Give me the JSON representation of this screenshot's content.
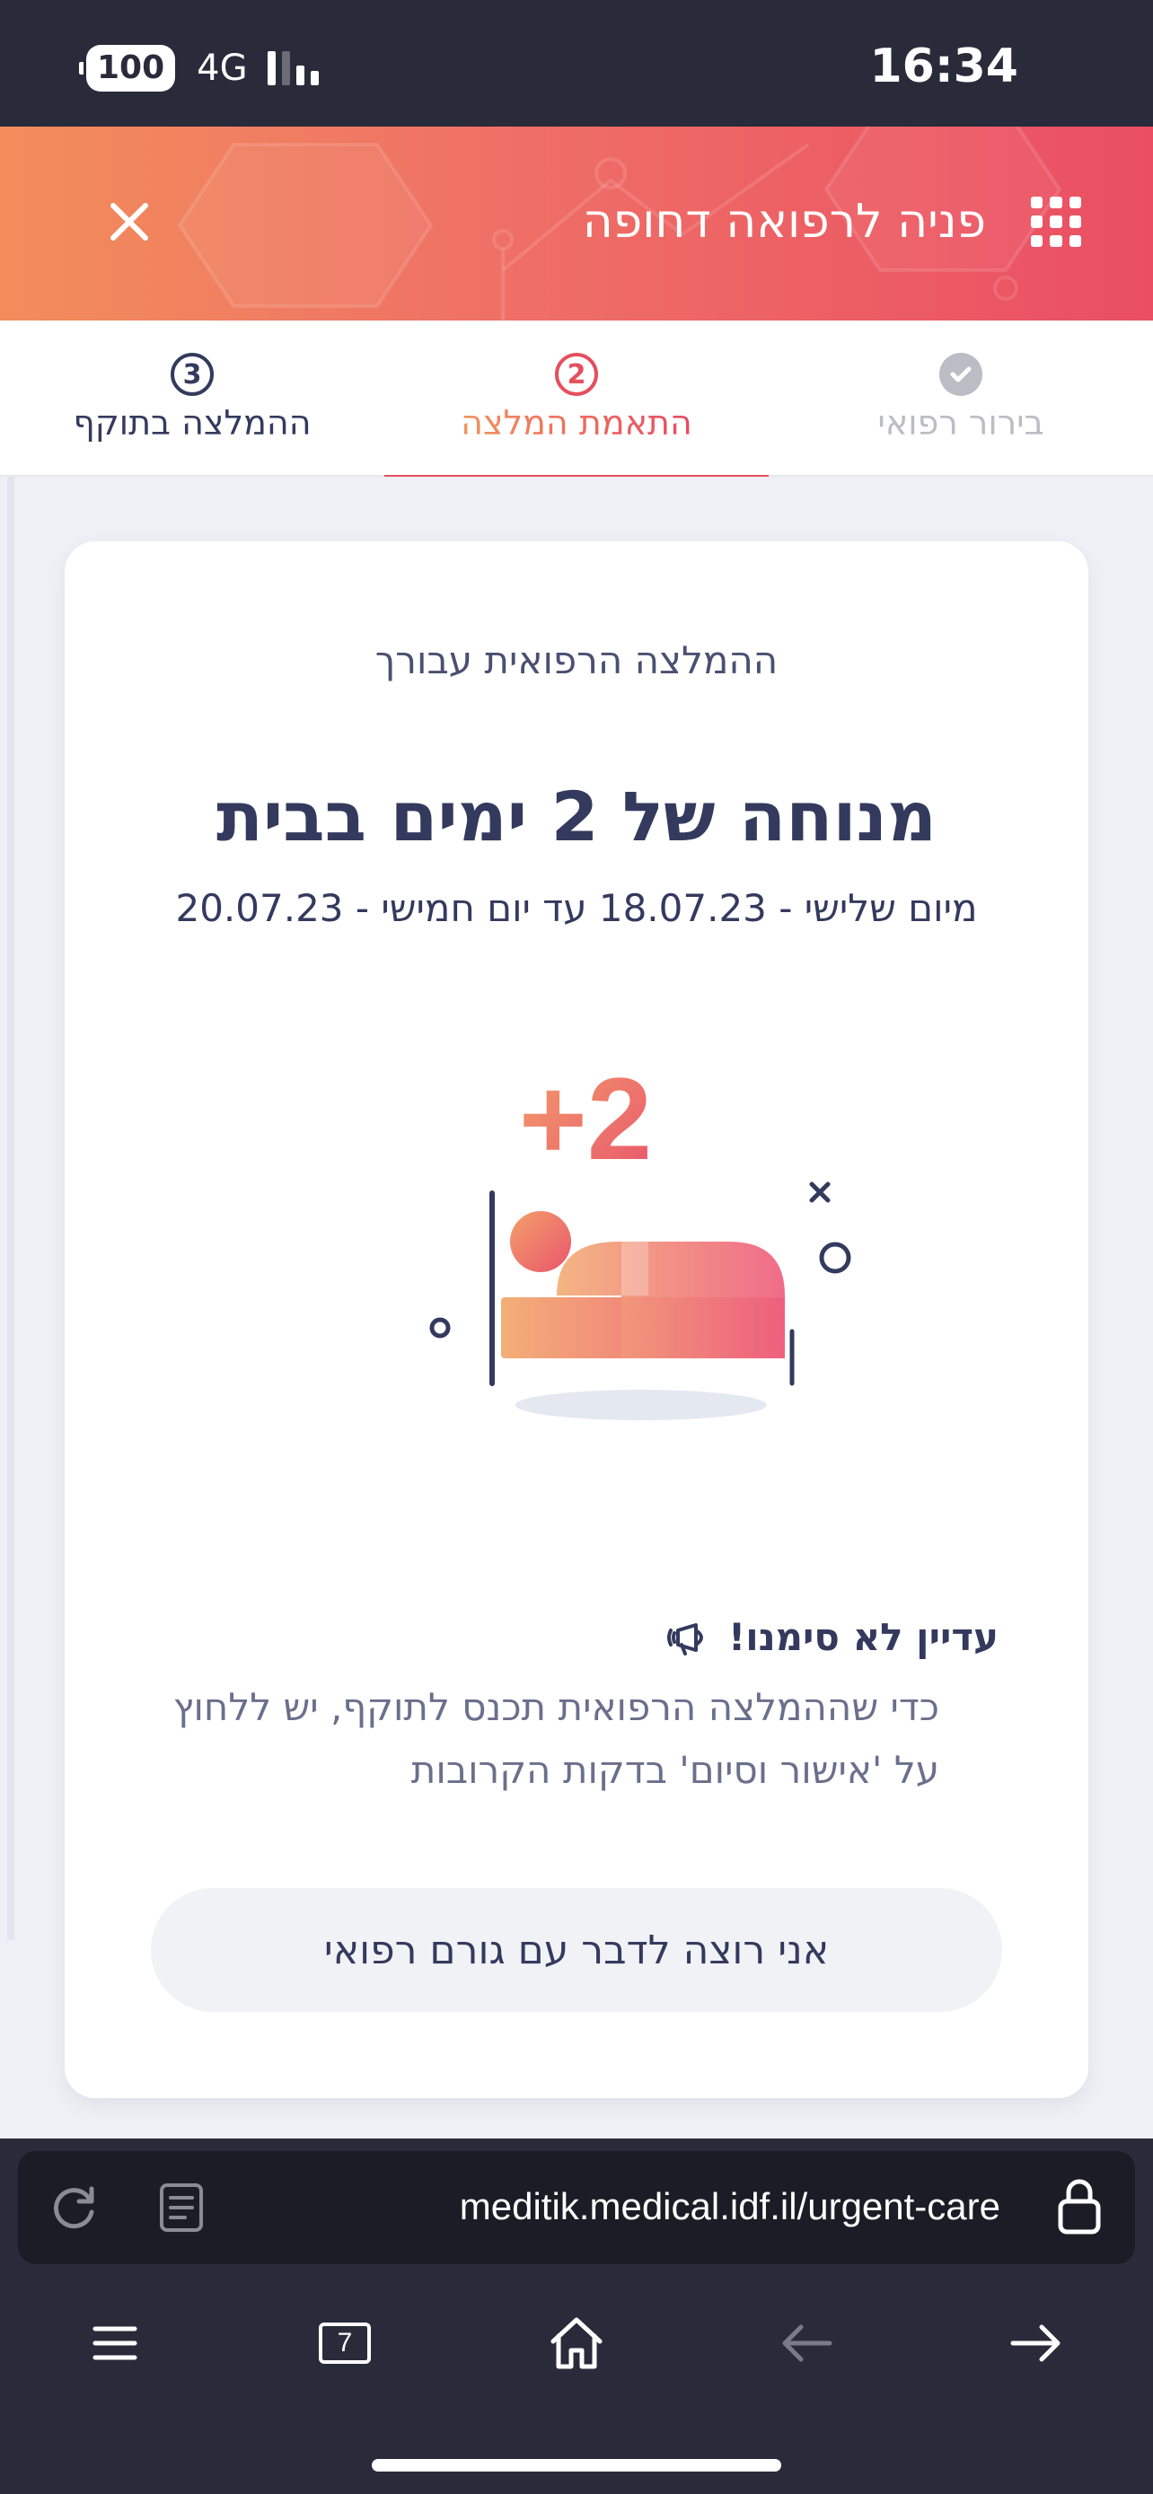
{
  "status_bar": {
    "battery": "100",
    "network": "4G",
    "time": "16:34"
  },
  "header": {
    "title": "פניה לרפואה דחופה"
  },
  "steps": [
    {
      "label": "בירור רפואי",
      "state": "done"
    },
    {
      "number": "2",
      "label": "התאמת המלצה",
      "state": "active"
    },
    {
      "number": "3",
      "label": "ההמלצה בתוקף",
      "state": "pending"
    }
  ],
  "card": {
    "subtitle": "ההמלצה הרפואית עבורך",
    "title": "מנוחה של 2 ימים בבית",
    "dates": "מיום שלישי - 18.07.23 עד יום חמישי - 20.07.23",
    "illustration_badge": "+2",
    "notice_title": "עדיין לא סימנו!",
    "notice_line1": "כדי שההמלצה הרפואית תכנס לתוקף, יש ללחוץ",
    "notice_line2": "על 'אישור וסיום' בדקות הקרובות",
    "talk_button": "אני רוצה לדבר עם גורם רפואי"
  },
  "browser": {
    "url": "meditik.medical.idf.il/urgent-care",
    "tabs_count": "7"
  },
  "colors": {
    "accent_start": "#f28d5b",
    "accent_end": "#ea4e63",
    "text_primary": "#343a5e"
  },
  "icons": [
    "close-icon",
    "apps-grid-icon",
    "check-icon",
    "megaphone-icon",
    "reload-icon",
    "reader-icon",
    "lock-icon",
    "menu-icon",
    "tabs-icon",
    "home-icon",
    "back-icon",
    "forward-icon"
  ]
}
